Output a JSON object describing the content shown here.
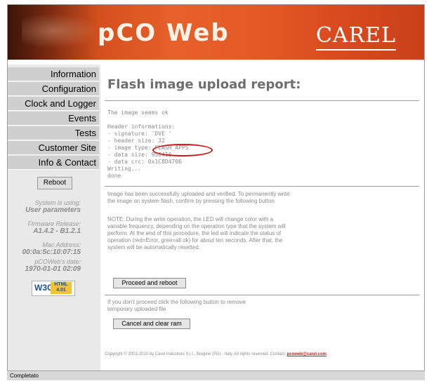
{
  "banner": {
    "logo_text": "pCO Web",
    "brand": "CAREL"
  },
  "sidebar": {
    "items": [
      {
        "label": "Information"
      },
      {
        "label": "Configuration"
      },
      {
        "label": "Clock and Logger"
      },
      {
        "label": "Events"
      },
      {
        "label": "Tests"
      },
      {
        "label": "Customer Site"
      },
      {
        "label": "Info & Contact"
      }
    ],
    "reboot_label": "Reboot",
    "system_using_label": "System is using:",
    "system_using_value": "User parameters",
    "firmware_label": "Firmware Release:",
    "firmware_value": "A1.4.2 - B1.2.1",
    "mac_label": "Mac Address:",
    "mac_value": "00:0a:5c:10:07:15",
    "date_label": "pCOWeb's date:",
    "date_value": "1970-01-01 02:09",
    "w3c_text": "W3C",
    "w3c_badge": "HTML 4.01"
  },
  "main": {
    "title": "Flash image upload report:",
    "status": "The image seems ok",
    "header_label": "Header informations:",
    "signature": "- signature: 'DVE '",
    "header_size": "- header size: 32",
    "image_type": "- image type: FLASH_APPS",
    "data_size": "- data size: 956416",
    "data_crc": "- data crc: 0x1C8D4706",
    "writing": "Writing...",
    "done": "done",
    "uploaded_msg": "Image has been successfully uploaded and verified. To permanently write the image on system flash, confirm by pressing the following button",
    "note_msg": "NOTE: During the write operation, the LED will change color with a variable frequency, depending on the operation type that the system will perform. At the end of this procedure, the led will indicate the status of operation (red=Error, gree=all ok) for about ten seconds. After that, the system will be automatically resetted.",
    "proceed_label": "Proceed and reboot",
    "cancel_msg": "If you don't proceed click the following button to remove temporary uploaded file",
    "cancel_label": "Cancel and clear ram",
    "copyright": "Copyright © 2003-2010 by Carel Industries S.r.l., Brugine (PD) - Italy. All rights reserved. Contact:",
    "contact_email": "pcoweb@carel.com"
  },
  "statusbar": {
    "text": "Completato"
  },
  "colors": {
    "banner": "#e05a26",
    "accent": "#d01818"
  }
}
